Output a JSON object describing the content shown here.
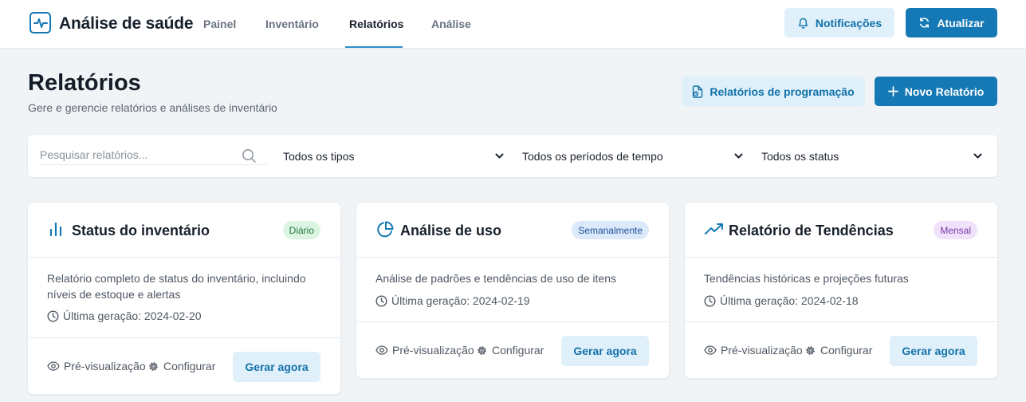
{
  "app": {
    "title": "Análise de saúde",
    "logo_icon": "activity-icon"
  },
  "nav": [
    {
      "label": "Painel",
      "active": false
    },
    {
      "label": "Inventário",
      "active": false
    },
    {
      "label": "Relatórios",
      "active": true
    },
    {
      "label": "Análise",
      "active": false
    }
  ],
  "header_actions": {
    "notifications_label": "Notificações",
    "refresh_label": "Atualizar"
  },
  "page": {
    "title": "Relatórios",
    "subtitle": "Gere e gerencie relatórios e análises de inventário",
    "schedule_label": "Relatórios de programação",
    "new_report_label": "Novo Relatório"
  },
  "filters": {
    "search_placeholder": "Pesquisar relatórios...",
    "type_value": "Todos os tipos",
    "period_value": "Todos os períodos de tempo",
    "status_value": "Todos os status"
  },
  "cards": [
    {
      "icon": "bar-chart-icon",
      "title": "Status do inventário",
      "badge": "Diário",
      "description": "Relatório completo de status do inventário, incluindo níveis de estoque e alertas",
      "last_generated": "Última geração: 2024-02-20",
      "preview_label": "Pré-visualização",
      "configure_label": "Configurar",
      "generate_label": "Gerar agora"
    },
    {
      "icon": "pie-chart-icon",
      "title": "Análise de uso",
      "badge": "Semanalmente",
      "description": "Análise de padrões e tendências de uso de itens",
      "last_generated": "Última geração: 2024-02-19",
      "preview_label": "Pré-visualização",
      "configure_label": "Configurar",
      "generate_label": "Gerar agora"
    },
    {
      "icon": "trending-up-icon",
      "title": "Relatório de Tendências",
      "badge": "Mensal",
      "description": "Tendências históricas e projeções futuras",
      "last_generated": "Última geração: 2024-02-18",
      "preview_label": "Pré-visualização",
      "configure_label": "Configurar",
      "generate_label": "Gerar agora"
    }
  ],
  "colors": {
    "primary": "#1579b5",
    "primary_light": "#dff0fb",
    "badge_daily_bg": "#dcf5e3",
    "badge_daily_text": "#1e7a3f",
    "badge_weekly_bg": "#dbe9fb",
    "badge_weekly_text": "#1e4f98",
    "badge_monthly_bg": "#f1e2fb",
    "badge_monthly_text": "#7a3aa8"
  }
}
